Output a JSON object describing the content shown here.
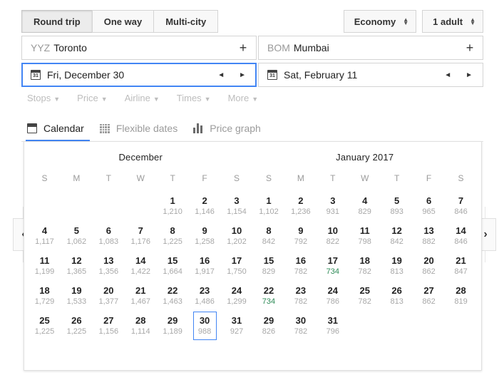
{
  "trip_types": [
    {
      "label": "Round trip",
      "active": true
    },
    {
      "label": "One way",
      "active": false
    },
    {
      "label": "Multi-city",
      "active": false
    }
  ],
  "cabin": {
    "label": "Economy"
  },
  "passengers": {
    "label": "1 adult"
  },
  "origin": {
    "code": "YYZ",
    "city": "Toronto",
    "add_label": "+"
  },
  "destination": {
    "code": "BOM",
    "city": "Mumbai",
    "add_label": "+"
  },
  "depart": {
    "value": "Fri, December 30",
    "icon_day": "31",
    "prev": "◄",
    "next": "►"
  },
  "return": {
    "value": "Sat, February 11",
    "icon_day": "31",
    "prev": "◄",
    "next": "►"
  },
  "filters": [
    {
      "label": "Stops"
    },
    {
      "label": "Price"
    },
    {
      "label": "Airline"
    },
    {
      "label": "Times"
    },
    {
      "label": "More"
    }
  ],
  "tabs": [
    {
      "label": "Calendar",
      "icon": "calendar-icon",
      "active": true
    },
    {
      "label": "Flexible dates",
      "icon": "grid-icon",
      "active": false
    },
    {
      "label": "Price graph",
      "icon": "bar-chart-icon",
      "active": false
    }
  ],
  "nav": {
    "prev": "‹",
    "next": "›"
  },
  "colors": {
    "accent": "#4285f4",
    "low_price": "#2e8b57",
    "price": "#a8a8a8"
  },
  "weekdays": [
    "S",
    "M",
    "T",
    "W",
    "T",
    "F",
    "S"
  ],
  "calendars": [
    {
      "title": "December",
      "weeks": [
        [
          null,
          null,
          null,
          null,
          {
            "day": "1",
            "price": "1,210"
          },
          {
            "day": "2",
            "price": "1,146"
          },
          {
            "day": "3",
            "price": "1,154"
          }
        ],
        [
          {
            "day": "4",
            "price": "1,117"
          },
          {
            "day": "5",
            "price": "1,062"
          },
          {
            "day": "6",
            "price": "1,083"
          },
          {
            "day": "7",
            "price": "1,176"
          },
          {
            "day": "8",
            "price": "1,225"
          },
          {
            "day": "9",
            "price": "1,258"
          },
          {
            "day": "10",
            "price": "1,202"
          }
        ],
        [
          {
            "day": "11",
            "price": "1,199"
          },
          {
            "day": "12",
            "price": "1,365"
          },
          {
            "day": "13",
            "price": "1,356"
          },
          {
            "day": "14",
            "price": "1,422"
          },
          {
            "day": "15",
            "price": "1,664"
          },
          {
            "day": "16",
            "price": "1,917"
          },
          {
            "day": "17",
            "price": "1,750"
          }
        ],
        [
          {
            "day": "18",
            "price": "1,729"
          },
          {
            "day": "19",
            "price": "1,533"
          },
          {
            "day": "20",
            "price": "1,377"
          },
          {
            "day": "21",
            "price": "1,467"
          },
          {
            "day": "22",
            "price": "1,463"
          },
          {
            "day": "23",
            "price": "1,486"
          },
          {
            "day": "24",
            "price": "1,299"
          }
        ],
        [
          {
            "day": "25",
            "price": "1,225"
          },
          {
            "day": "26",
            "price": "1,225"
          },
          {
            "day": "27",
            "price": "1,156"
          },
          {
            "day": "28",
            "price": "1,114"
          },
          {
            "day": "29",
            "price": "1,189"
          },
          {
            "day": "30",
            "price": "988",
            "selected": true
          },
          {
            "day": "31",
            "price": "927"
          }
        ]
      ]
    },
    {
      "title": "January 2017",
      "weeks": [
        [
          {
            "day": "1",
            "price": "1,102"
          },
          {
            "day": "2",
            "price": "1,236"
          },
          {
            "day": "3",
            "price": "931"
          },
          {
            "day": "4",
            "price": "829"
          },
          {
            "day": "5",
            "price": "893"
          },
          {
            "day": "6",
            "price": "965"
          },
          {
            "day": "7",
            "price": "846"
          }
        ],
        [
          {
            "day": "8",
            "price": "842"
          },
          {
            "day": "9",
            "price": "792"
          },
          {
            "day": "10",
            "price": "822"
          },
          {
            "day": "11",
            "price": "798"
          },
          {
            "day": "12",
            "price": "842"
          },
          {
            "day": "13",
            "price": "882"
          },
          {
            "day": "14",
            "price": "846"
          }
        ],
        [
          {
            "day": "15",
            "price": "829"
          },
          {
            "day": "16",
            "price": "782"
          },
          {
            "day": "17",
            "price": "734",
            "low": true
          },
          {
            "day": "18",
            "price": "782"
          },
          {
            "day": "19",
            "price": "813"
          },
          {
            "day": "20",
            "price": "862"
          },
          {
            "day": "21",
            "price": "847"
          }
        ],
        [
          {
            "day": "22",
            "price": "734",
            "low": true
          },
          {
            "day": "23",
            "price": "782"
          },
          {
            "day": "24",
            "price": "786"
          },
          {
            "day": "25",
            "price": "782"
          },
          {
            "day": "26",
            "price": "813"
          },
          {
            "day": "27",
            "price": "862"
          },
          {
            "day": "28",
            "price": "819"
          }
        ],
        [
          {
            "day": "29",
            "price": "826"
          },
          {
            "day": "30",
            "price": "782"
          },
          {
            "day": "31",
            "price": "796"
          },
          null,
          null,
          null,
          null
        ]
      ]
    }
  ]
}
